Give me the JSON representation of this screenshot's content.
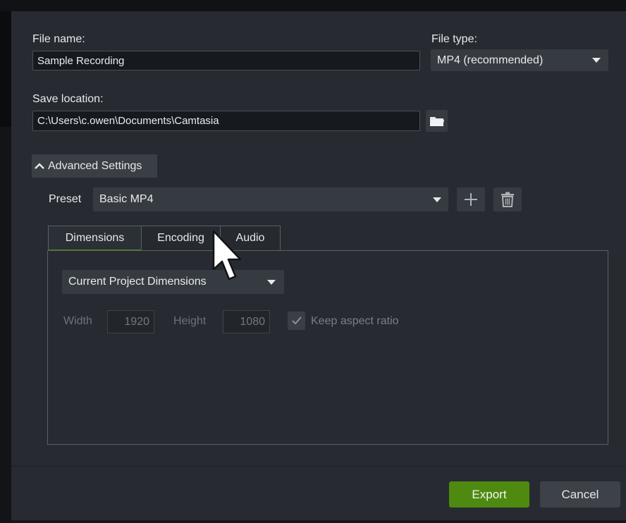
{
  "dialog": {
    "file_name": {
      "label": "File name:",
      "value": "Sample Recording"
    },
    "file_type": {
      "label": "File type:",
      "selected": "MP4 (recommended)"
    },
    "save_location": {
      "label": "Save location:",
      "value": "C:\\Users\\c.owen\\Documents\\Camtasia"
    },
    "advanced": {
      "toggle_label": "Advanced Settings",
      "preset": {
        "label": "Preset",
        "selected": "Basic MP4"
      },
      "tabs": [
        {
          "label": "Dimensions",
          "active": true
        },
        {
          "label": "Encoding",
          "active": false
        },
        {
          "label": "Audio",
          "active": false
        }
      ],
      "dimensions": {
        "mode_selected": "Current Project Dimensions",
        "width_label": "Width",
        "width_value": "1920",
        "height_label": "Height",
        "height_value": "1080",
        "keep_aspect_label": "Keep aspect ratio",
        "keep_aspect_checked": true
      }
    },
    "buttons": {
      "export_label": "Export",
      "cancel_label": "Cancel"
    }
  },
  "colors": {
    "accent": "#4f8a14",
    "export_button": "#4e8a10",
    "background": "#272b31"
  },
  "icons": [
    "folder-icon",
    "chevron-up-icon",
    "plus-icon",
    "trash-icon",
    "caret-down-icon",
    "check-icon",
    "mouse-cursor-icon"
  ]
}
